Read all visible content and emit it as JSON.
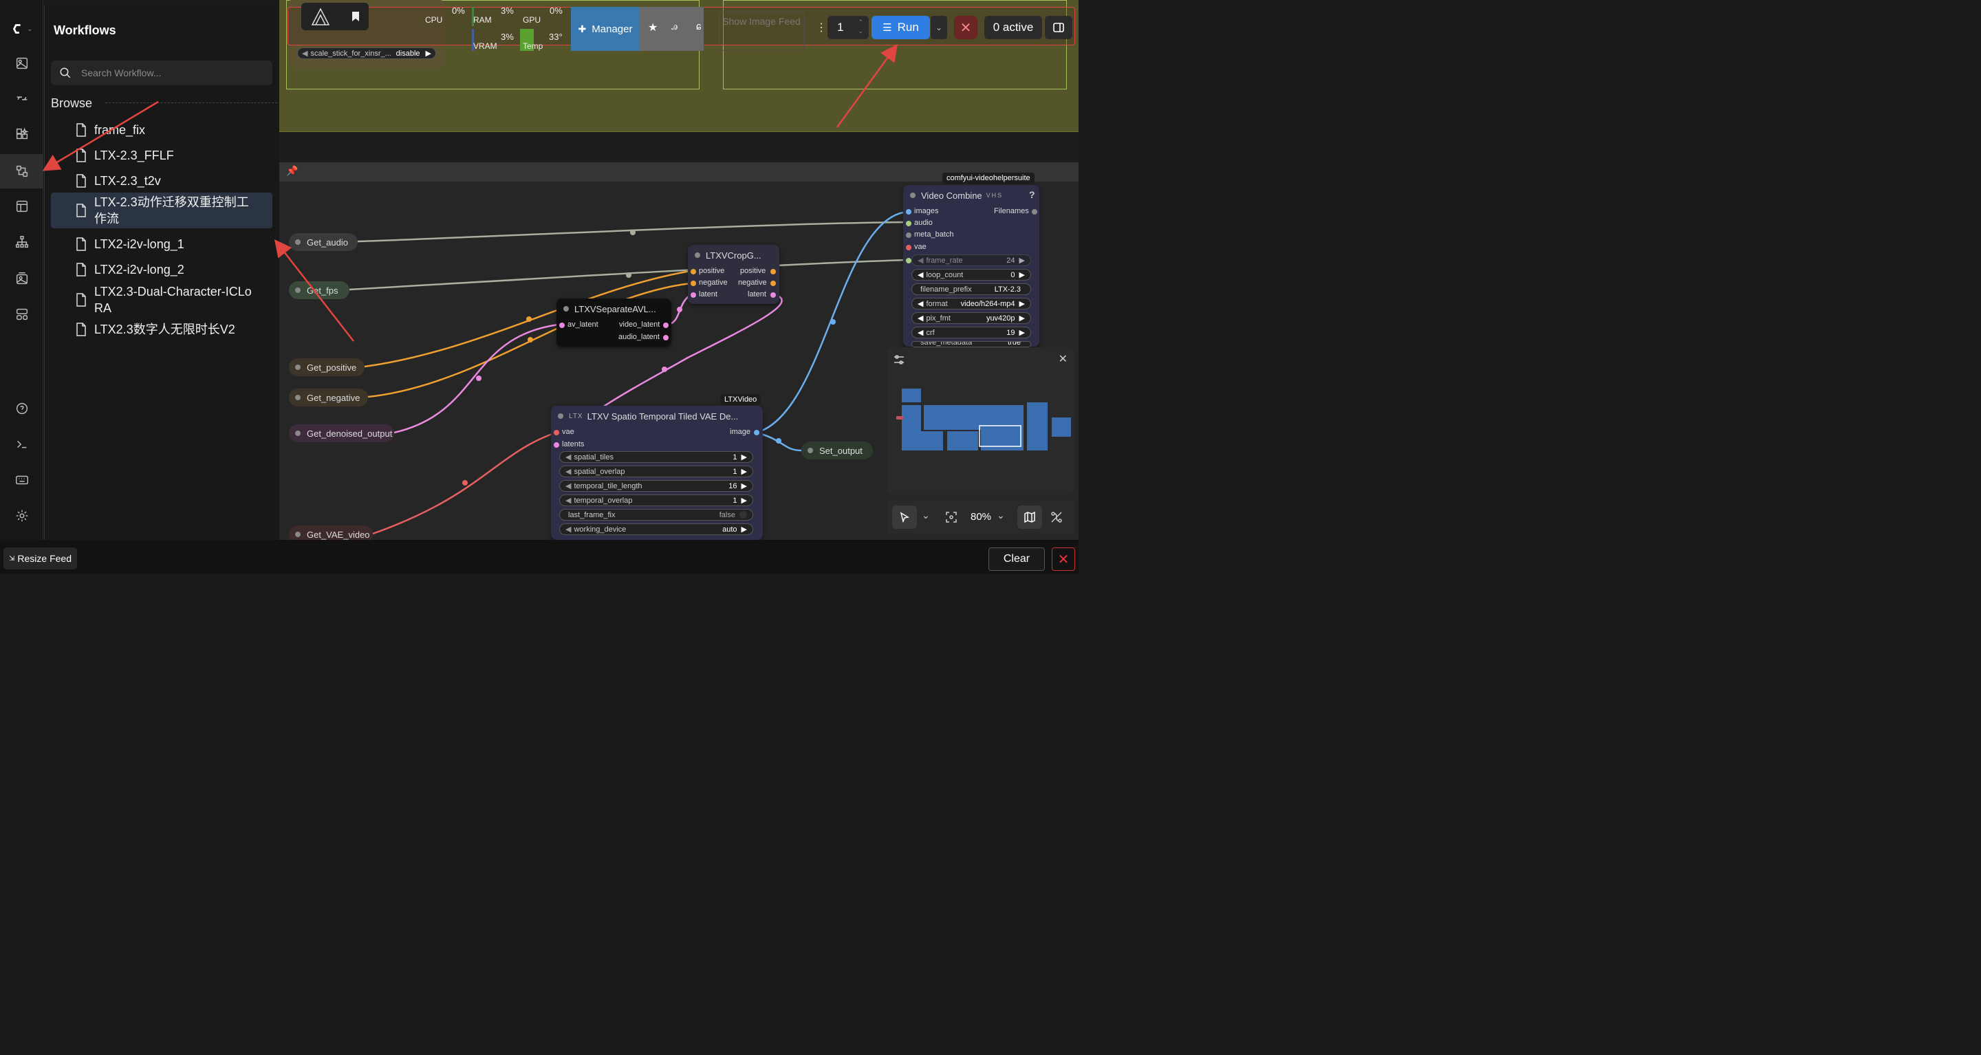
{
  "sidebar": {
    "title": "Workflows",
    "search_placeholder": "Search Workflow...",
    "browse_label": "Browse",
    "items": [
      {
        "label": "frame_fix"
      },
      {
        "label": "LTX-2.3_FFLF"
      },
      {
        "label": "LTX-2.3_t2v"
      },
      {
        "label": "LTX-2.3动作迁移双重控制工作流",
        "line1": "LTX-2.3动作迁移双重控制工",
        "line2": "作流",
        "selected": true
      },
      {
        "label": "LTX2-i2v-long_1"
      },
      {
        "label": "LTX2-i2v-long_2"
      },
      {
        "label": "LTX2.3-Dual-Character-ICLoRA",
        "line1": "LTX2.3-Dual-Character-ICLo",
        "line2": "RA"
      },
      {
        "label": "LTX2.3数字人无限时长V2"
      }
    ]
  },
  "rail_icons": [
    "logo-icon",
    "images-icon",
    "nodes-icon",
    "models-icon",
    "workflows-icon",
    "templates-icon",
    "node-library-icon",
    "gallery-icon",
    "layout-icon",
    "help-icon",
    "terminal-icon",
    "keyboard-icon",
    "settings-icon"
  ],
  "toolbar": {
    "stats": {
      "cpu_label": "CPU",
      "cpu_value": "0%",
      "ram_label": "RAM",
      "ram_value": "3%",
      "gpu_label": "GPU",
      "gpu_value": "0%",
      "vram_label": "VRAM",
      "vram_value": "3%",
      "temp_label": "Temp",
      "temp_value": "33°"
    },
    "manager_label": "Manager",
    "show_image_feed": "Show Image Feed",
    "queue_count": "1",
    "run_label": "Run",
    "active_label": "0 active"
  },
  "canvas": {
    "scale_widget": {
      "label": "scale_stick_for_xinsr_...",
      "value": "disable"
    },
    "get_nodes": [
      "Get_audio",
      "Get_fps",
      "Get_positive",
      "Get_negative",
      "Get_denoised_output",
      "Get_VAE_video"
    ],
    "set_node": "Set_output",
    "crop_node": {
      "title": "LTXVCropG...",
      "inputs": [
        "positive",
        "negative",
        "latent"
      ],
      "outputs": [
        "positive",
        "negative",
        "latent"
      ]
    },
    "separate_node": {
      "title": "LTXVSeparateAVL...",
      "inputs": [
        "av_latent"
      ],
      "outputs": [
        "video_latent",
        "audio_latent"
      ]
    },
    "vae_node": {
      "badge": "LTXVideo",
      "title": "LTXV Spatio Temporal Tiled VAE De...",
      "title_prefix": "LTX",
      "inputs": [
        "vae",
        "latents"
      ],
      "outputs": [
        "image"
      ],
      "widgets": [
        {
          "label": "spatial_tiles",
          "value": "1"
        },
        {
          "label": "spatial_overlap",
          "value": "1"
        },
        {
          "label": "temporal_tile_length",
          "value": "16"
        },
        {
          "label": "temporal_overlap",
          "value": "1"
        },
        {
          "label": "last_frame_fix",
          "value": "false"
        },
        {
          "label": "working_device",
          "value": "auto"
        }
      ]
    },
    "combine_node": {
      "badge": "comfyui-videohelpersuite",
      "title": "Video Combine",
      "title_suffix": "VHS",
      "help": "?",
      "inputs": [
        "images",
        "audio",
        "meta_batch",
        "vae"
      ],
      "outputs": [
        "Filenames"
      ],
      "widgets": [
        {
          "label": "frame_rate",
          "value": "24"
        },
        {
          "label": "loop_count",
          "value": "0"
        },
        {
          "label": "filename_prefix",
          "value": "LTX-2.3"
        },
        {
          "label": "format",
          "value": "video/h264-mp4"
        },
        {
          "label": "pix_fmt",
          "value": "yuv420p"
        },
        {
          "label": "crf",
          "value": "19"
        },
        {
          "label": "save_metadata",
          "value": "true"
        }
      ]
    }
  },
  "zoom": {
    "level": "80%"
  },
  "bottom": {
    "resize_feed": "Resize Feed",
    "clear": "Clear"
  },
  "colors": {
    "accent": "#2e7ee3",
    "manager": "#3a78b0",
    "annotation": "#e0453f",
    "link_orange": "#f0a030",
    "link_pink": "#e98ae0",
    "link_blue": "#6ab0f0",
    "link_red": "#e66060",
    "link_gray": "#a8b0a0"
  }
}
